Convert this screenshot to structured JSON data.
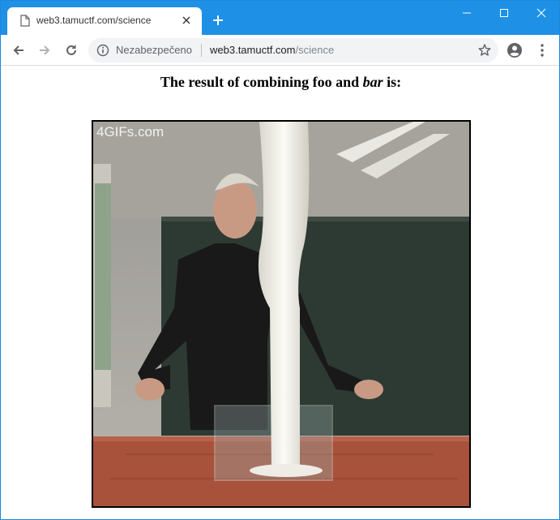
{
  "browser": {
    "tab_title": "web3.tamuctf.com/science",
    "security_label": "Nezabezpečeno",
    "url_host": "web3.tamuctf.com",
    "url_path": "/science"
  },
  "page": {
    "heading_prefix": "The result of combining foo and ",
    "heading_italic": "bar",
    "heading_suffix": " is:",
    "gif_watermark": "4GIFs.com"
  },
  "icons": {
    "tab_icon": "page-icon",
    "close": "close-icon",
    "new_tab": "plus-icon",
    "back": "arrow-left-icon",
    "forward": "arrow-right-icon",
    "reload": "reload-icon",
    "info": "info-icon",
    "bookmark": "star-icon",
    "account": "account-icon",
    "menu": "kebab-menu-icon"
  },
  "colors": {
    "titlebar": "#1e90e6",
    "omnibox": "#f1f3f4"
  }
}
